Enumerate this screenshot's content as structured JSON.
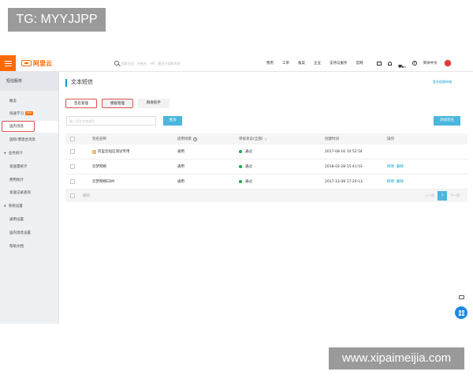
{
  "watermark": {
    "top": "TG: MYYJJPP",
    "bottom": "www.xipaimeijia.com"
  },
  "header": {
    "logo_text": "阿里云",
    "search_placeholder": "搜索文档、控制台、API、解决方案和资源",
    "nav": [
      "费用",
      "工单",
      "备案",
      "企业",
      "支持与服务",
      "官网"
    ],
    "cart_count": "0",
    "language": "简体中文"
  },
  "sidebar": {
    "title": "短信服务",
    "items": [
      {
        "label": "概览",
        "type": "sub"
      },
      {
        "label": "快速学习",
        "type": "sub",
        "badge": "NEW"
      },
      {
        "label": "国内消息",
        "type": "sub",
        "active": true
      },
      {
        "label": "国际/港澳台消息",
        "type": "sub"
      },
      {
        "label": "业务统计",
        "type": "group"
      },
      {
        "label": "发送量统计",
        "type": "sub"
      },
      {
        "label": "费用统计",
        "type": "sub"
      },
      {
        "label": "发送记录查询",
        "type": "sub"
      },
      {
        "label": "系统设置",
        "type": "group"
      },
      {
        "label": "通用设置",
        "type": "sub"
      },
      {
        "label": "国内消息设置",
        "type": "sub"
      },
      {
        "label": "帮助文档",
        "type": "sub"
      }
    ]
  },
  "main": {
    "title": "文本短信",
    "guide_link": "签名权限申请",
    "tabs": [
      "签名管理",
      "模板管理",
      "群发助手"
    ],
    "filter_placeholder": "输入签名名称或ID",
    "search_button": "查询",
    "add_button": "添加签名",
    "table": {
      "headers": {
        "name": "签名名称",
        "scope": "适用场景",
        "status": "审核状态(全部)",
        "created": "创建时间",
        "ops": "操作"
      },
      "rows": [
        {
          "name": "阿里云短信测试专用",
          "scope": "通用",
          "status": "通过",
          "created": "2017-08-16 10:52:54",
          "ops": []
        },
        {
          "name": "云梦网络",
          "scope": "通用",
          "status": "通过",
          "created": "2018-02-28 15:41:53",
          "ops": [
            "修改",
            "删除"
          ]
        },
        {
          "name": "云梦网络EDM",
          "scope": "通用",
          "status": "通过",
          "created": "2017-12-08 17:20:13",
          "ops": [
            "修改",
            "删除"
          ]
        }
      ],
      "footer": {
        "delete_label": "删除",
        "prev": "上一页",
        "page": "1",
        "next": "下一页"
      }
    }
  },
  "colors": {
    "brand": "#ff6a00",
    "accent": "#00a2ca",
    "button": "#4bb6de",
    "success": "#1aa94e",
    "highlight": "#d9534f"
  }
}
